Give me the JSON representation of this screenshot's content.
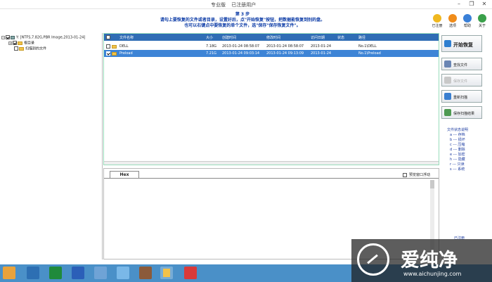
{
  "titlebar": {
    "edition": "专业版",
    "registration": "已注册用户"
  },
  "banner": {
    "step": "第 3 步",
    "line1": "请勾上要恢复的文件或者目录，设置好后，点\"开始恢复\"按钮，把数据能恢复到别的盘。",
    "line2": "也可以右键点中要恢复的单个文件，选\"保存\"保存恢复文件\"。"
  },
  "topicons": [
    {
      "icon": "register-icon",
      "label": "已注册",
      "color": "#f0b820"
    },
    {
      "icon": "options-icon",
      "label": "选项",
      "color": "#f08c1a"
    },
    {
      "icon": "help-icon",
      "label": "帮助",
      "color": "#3a80d8"
    },
    {
      "icon": "about-icon",
      "label": "关于",
      "color": "#3aa04a"
    }
  ],
  "tree": {
    "drive": "Y: [NTFS,7.82G,PBR Image,2013-01-24]",
    "root": "根目录",
    "scanned": "扫描到的文件"
  },
  "table": {
    "headers": [
      "文件名称",
      "大小",
      "创建时间",
      "修改时间",
      "访问日期",
      "状态",
      "路径"
    ],
    "rows": [
      {
        "name": "DELL",
        "size": "7.18G",
        "created": "2013-01-24 08:58:07",
        "modified": "2013-01-24 08:58:07",
        "accessed": "2013-01-24",
        "status": "",
        "path": "No.1\\DELL",
        "checked": false,
        "selected": false
      },
      {
        "name": "Preload",
        "size": "7.21G",
        "created": "2013-01-24 09:03:14",
        "modified": "2013-01-24 09:13:09",
        "accessed": "2013-01-24",
        "status": "",
        "path": "No.1\\Preload",
        "checked": true,
        "selected": true
      }
    ]
  },
  "hex": {
    "tab": "Hex",
    "preview_option": "预览窗口浮动"
  },
  "actions": {
    "start": "开始恢复",
    "find": "查找文件",
    "save_file": "保存文件",
    "rescan": "重新扫描",
    "save_scan": "保存扫描结果"
  },
  "legend": {
    "title": "文件状态说明",
    "items": [
      "a --- 存档",
      "b --- 损坏",
      "c --- 压缩",
      "d --- 删除",
      "e --- 加密",
      "h --- 隐藏",
      "r --- 只读",
      "s --- 系统"
    ]
  },
  "registered_text": "已注册",
  "watermark": {
    "text": "爱纯净",
    "url": "www.aichunjing.com"
  },
  "colors": {
    "header": "#2f6db5",
    "selection": "#3d84d6",
    "accent_text": "#0a3aa6",
    "taskbar": "#4a90c8"
  }
}
